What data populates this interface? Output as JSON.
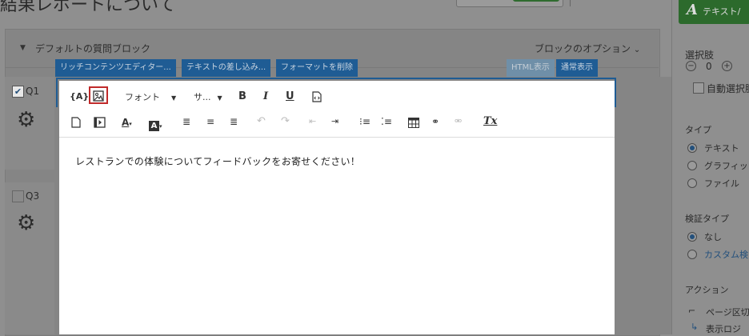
{
  "page": {
    "title": "結果レポートについて"
  },
  "block": {
    "title": "デフォルトの質問ブロック",
    "options": "ブロックのオプション"
  },
  "questions": [
    {
      "label": "Q1",
      "checked": true
    },
    {
      "label": "Q3",
      "checked": false
    }
  ],
  "editor": {
    "tabs": [
      "リッチコンテンツエディター...",
      "テキストの差し込み...",
      "フォーマットを削除"
    ],
    "view_tabs": [
      "HTML表示",
      "通常表示"
    ],
    "toolbar": {
      "piped_text": "{A}",
      "font_label": "フォント",
      "size_label": "サ...",
      "bold": "B",
      "italic": "I",
      "underline": "U",
      "clear_format": "Tx"
    },
    "content": "レストランでの体験についてフィードバックをお寄せください！"
  },
  "sidebar": {
    "change_type_label": "テキスト/",
    "choices_label": "選択肢",
    "choices_count": "0",
    "auto_choice_label": "自動選択肢",
    "type_label": "タイプ",
    "type_options": [
      "テキスト",
      "グラフィッ",
      "ファイル"
    ],
    "validation_label": "検証タイプ",
    "validation_options": [
      "なし",
      "カスタム検"
    ],
    "actions_label": "アクション",
    "action_items": [
      "ページ区切",
      "表示ロジ"
    ]
  },
  "colors": {
    "accent_blue": "#1f5c94",
    "highlight_red": "#c02a2a",
    "sidebar_green": "#2c6a2c"
  }
}
